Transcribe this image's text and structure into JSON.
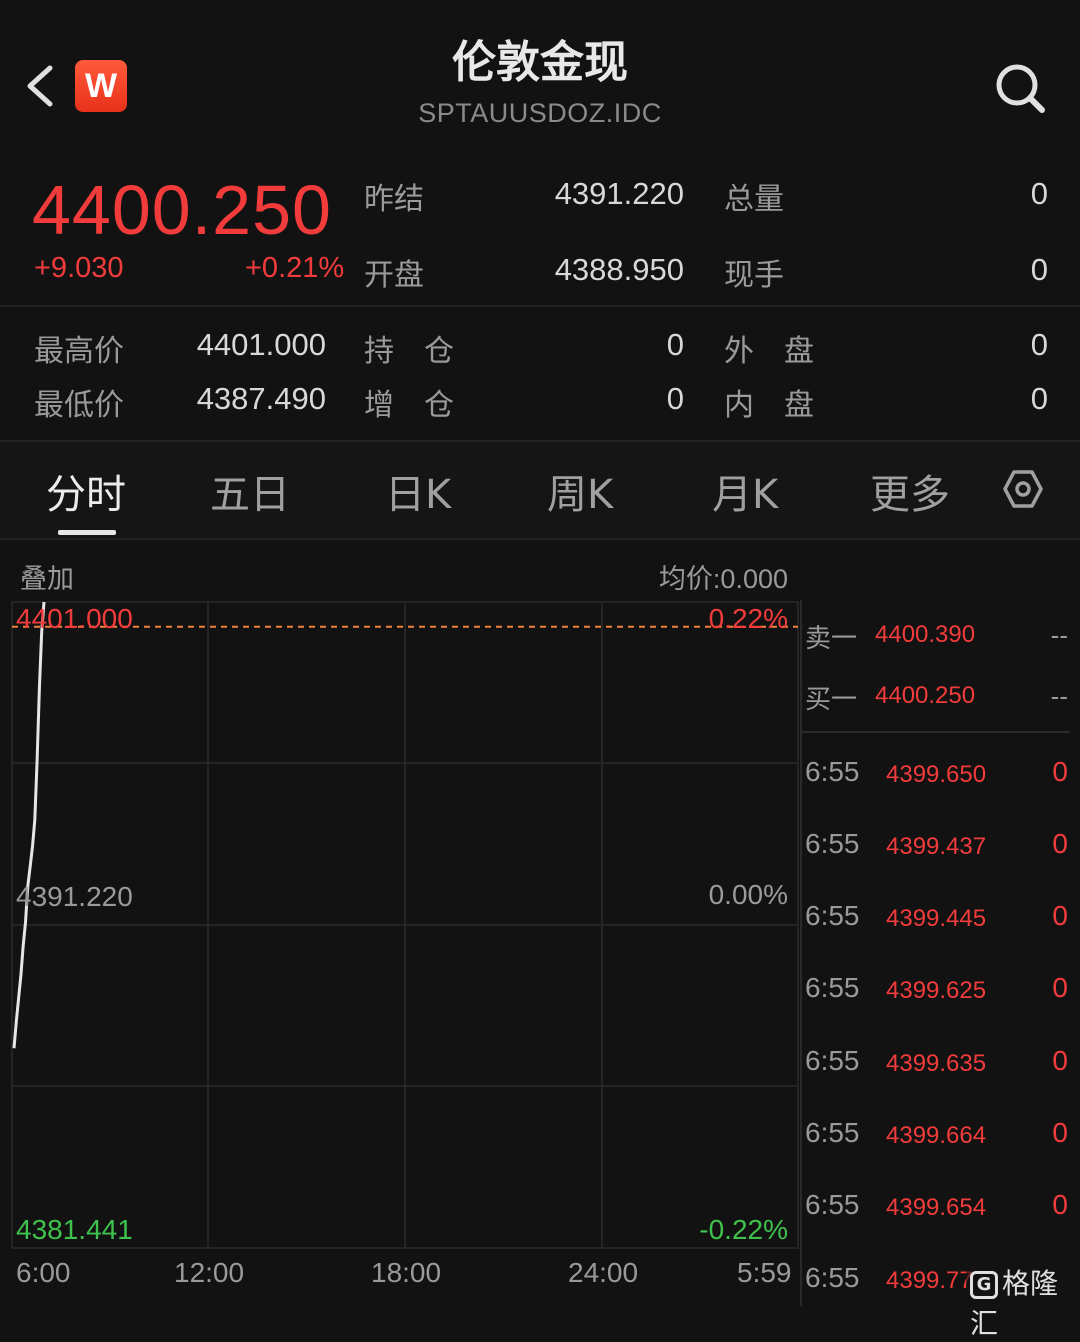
{
  "header": {
    "title": "伦敦金现",
    "subtitle": "SPTAUUSDOZ.IDC",
    "logo_letter": "W"
  },
  "quote": {
    "price": "4400.250",
    "change": "+9.030",
    "change_pct": "+0.21%",
    "prev_settle_label": "昨结",
    "prev_settle": "4391.220",
    "open_label": "开盘",
    "open": "4388.950",
    "total_vol_label": "总量",
    "total_vol": "0",
    "cur_hand_label": "现手",
    "cur_hand": "0",
    "high_label": "最高价",
    "high": "4401.000",
    "low_label": "最低价",
    "low": "4387.490",
    "open_interest_label": "持　仓",
    "open_interest": "0",
    "add_pos_label": "增　仓",
    "add_pos": "0",
    "outer_label": "外　盘",
    "outer": "0",
    "inner_label": "内　盘",
    "inner": "0"
  },
  "tabs": [
    "分时",
    "五日",
    "日K",
    "周K",
    "月K",
    "更多"
  ],
  "chart": {
    "overlay_label": "叠加",
    "avg_price": "均价:0.000",
    "top_price": "4401.000",
    "top_pct": "0.22%",
    "mid_price": "4391.220",
    "mid_pct": "0.00%",
    "bottom_price": "4381.441",
    "bottom_pct": "-0.22%",
    "x_labels": [
      "6:00",
      "12:00",
      "18:00",
      "24:00",
      "5:59"
    ]
  },
  "chart_data": {
    "type": "line",
    "ylim": [
      4381.441,
      4401.0
    ],
    "reference": 4391.22,
    "x_range_minutes": 1439,
    "series": [
      {
        "values": [
          4387.49,
          4388.3,
          4389.0,
          4389.7,
          4390.6,
          4391.3,
          4392.4,
          4393.0,
          4393.6,
          4394.4,
          4396.2,
          4398.4,
          4400.1,
          4401.0
        ]
      }
    ]
  },
  "orderbook": {
    "sell1_label": "卖一",
    "sell1_price": "4400.390",
    "sell1_vol": "--",
    "buy1_label": "买一",
    "buy1_price": "4400.250",
    "buy1_vol": "--"
  },
  "ticks": [
    {
      "time": "6:55",
      "price": "4399.650",
      "vol": "0"
    },
    {
      "time": "6:55",
      "price": "4399.437",
      "vol": "0"
    },
    {
      "time": "6:55",
      "price": "4399.445",
      "vol": "0"
    },
    {
      "time": "6:55",
      "price": "4399.625",
      "vol": "0"
    },
    {
      "time": "6:55",
      "price": "4399.635",
      "vol": "0"
    },
    {
      "time": "6:55",
      "price": "4399.664",
      "vol": "0"
    },
    {
      "time": "6:55",
      "price": "4399.654",
      "vol": "0"
    },
    {
      "time": "6:55",
      "price": "4399.77",
      "vol": ""
    }
  ],
  "watermark": "格隆汇",
  "colors": {
    "up": "#f23c3c",
    "down": "#3fc24d",
    "line": "#e6e6e6",
    "bg": "#121212"
  }
}
